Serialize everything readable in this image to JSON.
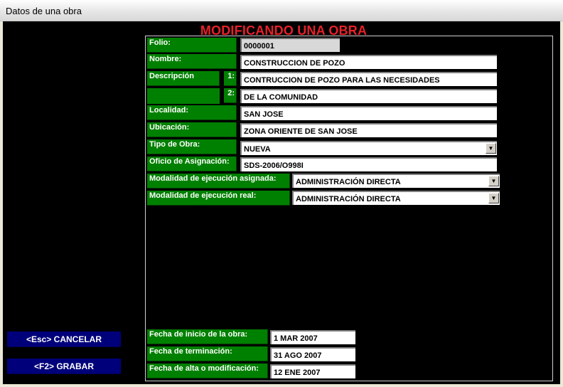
{
  "window": {
    "title": "Datos de una obra"
  },
  "form": {
    "heading": "MODIFICANDO UNA OBRA",
    "folio": {
      "label": "Folio:",
      "value": "0000001"
    },
    "nombre": {
      "label": "Nombre:",
      "value": "CONSTRUCCION DE POZO"
    },
    "descripcion": {
      "label": "Descripción",
      "line1_num": "1:",
      "line1": "CONTRUCCION DE POZO PARA LAS NECESIDADES",
      "line2_num": "2:",
      "line2": "DE LA COMUNIDAD"
    },
    "localidad": {
      "label": "Localidad:",
      "value": "SAN JOSE"
    },
    "ubicacion": {
      "label": "Ubicación:",
      "value": "ZONA ORIENTE DE SAN JOSE"
    },
    "tipo_obra": {
      "label": "Tipo de Obra:",
      "value": "NUEVA"
    },
    "oficio": {
      "label": "Oficio de Asignación:",
      "value": "SDS-2006/O998I"
    },
    "modalidad_asignada": {
      "label": "Modalidad de ejecución asignada:",
      "value": "ADMINISTRACIÓN DIRECTA"
    },
    "modalidad_real": {
      "label": "Modalidad de ejecución real:",
      "value": "ADMINISTRACIÓN DIRECTA"
    },
    "fecha_inicio": {
      "label": "Fecha de inicio de la obra:",
      "value": "1 MAR 2007"
    },
    "fecha_terminacion": {
      "label": "Fecha de terminación:",
      "value": "31 AGO 2007"
    },
    "fecha_alta": {
      "label": "Fecha de alta o modificación:",
      "value": "12 ENE 2007"
    }
  },
  "buttons": {
    "cancelar": "<Esc>  CANCELAR",
    "grabar": "<F2>  GRABAR"
  },
  "icons": {
    "dropdown": "chevron-down-icon"
  },
  "colors": {
    "label_bg": "#008000",
    "heading": "#e8202a",
    "button_bg": "#00007a"
  }
}
